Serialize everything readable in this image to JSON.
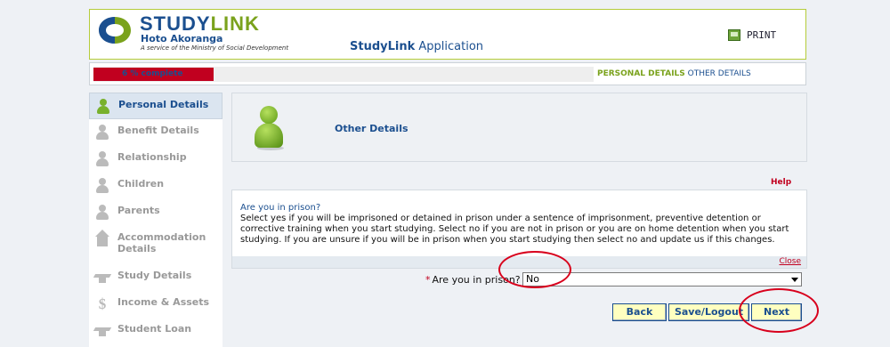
{
  "header": {
    "logo_main_a": "STUDY",
    "logo_main_b": "LINK",
    "logo_sub": "Hoto Akoranga",
    "logo_tag": "A service of the Ministry of Social Development",
    "app_title_bold": "StudyLink",
    "app_title_rest": "Application",
    "print_label": "PRINT"
  },
  "progress": {
    "percent": 6,
    "label": "6 % complete",
    "step_current": "PERSONAL DETAILS",
    "step_next": "OTHER DETAILS"
  },
  "sidebar": {
    "items": [
      {
        "label": "Personal Details",
        "icon": "person-icon",
        "active": true
      },
      {
        "label": "Benefit Details",
        "icon": "benefit-icon",
        "active": false
      },
      {
        "label": "Relationship",
        "icon": "relationship-icon",
        "active": false
      },
      {
        "label": "Children",
        "icon": "children-icon",
        "active": false
      },
      {
        "label": "Parents",
        "icon": "parents-icon",
        "active": false
      },
      {
        "label": "Accommodation Details",
        "icon": "house-icon",
        "active": false
      },
      {
        "label": "Study Details",
        "icon": "graduation-cap-icon",
        "active": false
      },
      {
        "label": "Income & Assets",
        "icon": "dollar-icon",
        "active": false
      },
      {
        "label": "Student Loan",
        "icon": "graduation-cap-icon",
        "active": false
      }
    ]
  },
  "panel": {
    "title": "Other Details"
  },
  "help": {
    "link": "Help",
    "question_title": "Are you in prison?",
    "question_body": "Select yes if you will be imprisoned or detained in prison under a sentence of imprisonment, preventive detention or corrective training when you start studying. Select no if you are not in prison or you are on home detention when you start studying. If you are unsure if you will be in prison when you start studying then select no and update us if this changes.",
    "close": "Close"
  },
  "form": {
    "required_mark": "*",
    "prison_label": "Are you in prison?",
    "prison_value": "No"
  },
  "buttons": {
    "back": "Back",
    "save_logout": "Save/Logout",
    "next": "Next"
  },
  "colors": {
    "brand_blue": "#1b4f8f",
    "brand_green": "#7aa21c",
    "accent_red": "#c1001f",
    "button_bg": "#ffffc0"
  }
}
